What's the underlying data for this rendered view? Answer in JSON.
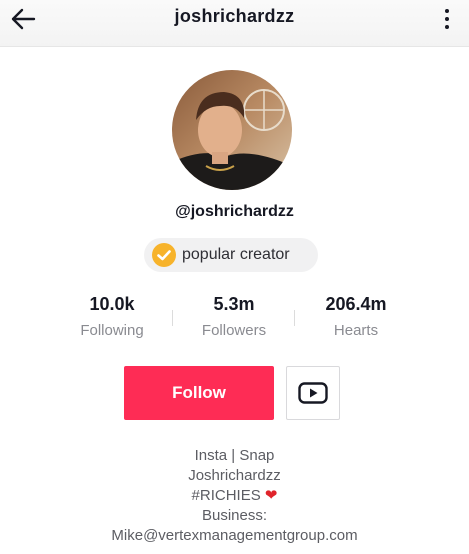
{
  "header": {
    "title": "joshrichardzz"
  },
  "profile": {
    "handle": "@joshrichardzz",
    "badge_label": "popular creator"
  },
  "stats": [
    {
      "value": "10.0k",
      "label": "Following"
    },
    {
      "value": "5.3m",
      "label": "Followers"
    },
    {
      "value": "206.4m",
      "label": "Hearts"
    }
  ],
  "actions": {
    "follow_label": "Follow"
  },
  "bio": {
    "line1": "Insta | Snap",
    "line2": "Joshrichardzz",
    "line3": "#RICHIES",
    "line3_emoji": "❤",
    "line4": "Business:",
    "line5": "Mike@vertexmanagementgroup.com"
  },
  "colors": {
    "accent": "#fe2c55",
    "badge_check": "#f7b32b"
  }
}
